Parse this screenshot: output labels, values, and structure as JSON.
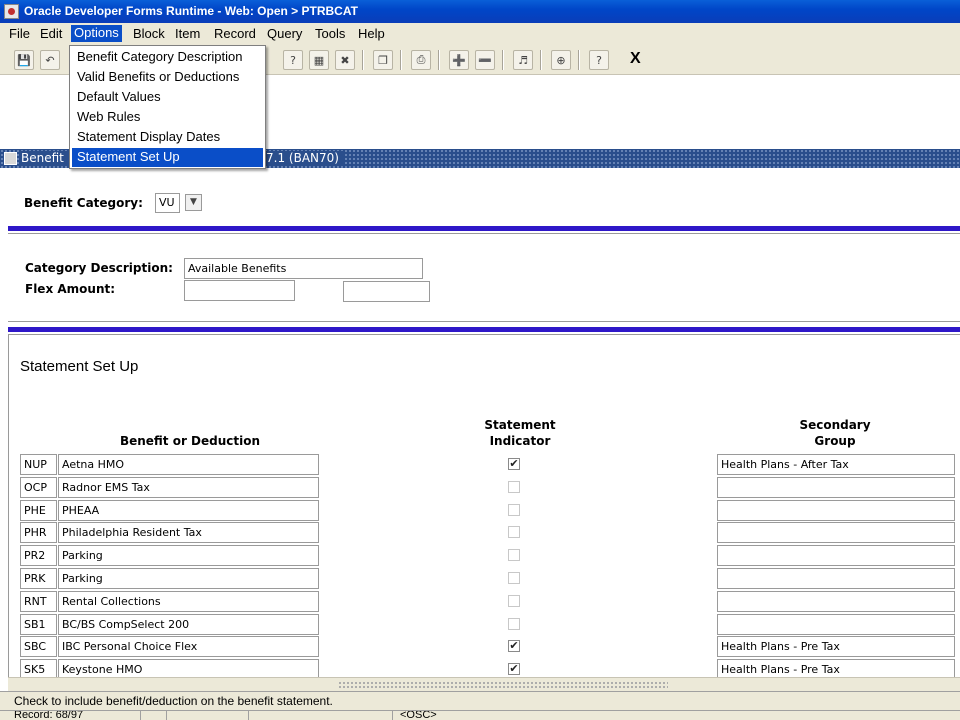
{
  "window": {
    "title": "Oracle Developer Forms Runtime - Web:  Open > PTRBCAT"
  },
  "menubar": {
    "items": [
      {
        "label": "File"
      },
      {
        "label": "Edit"
      },
      {
        "label": "Options"
      },
      {
        "label": "Block"
      },
      {
        "label": "Item"
      },
      {
        "label": "Record"
      },
      {
        "label": "Query"
      },
      {
        "label": "Tools"
      },
      {
        "label": "Help"
      }
    ],
    "active": "Options"
  },
  "toolbar": {
    "exit_label": "X"
  },
  "options_menu": {
    "items": [
      {
        "label": "Benefit Category Description"
      },
      {
        "label": "Valid Benefits or Deductions"
      },
      {
        "label": "Default Values"
      },
      {
        "label": "Web Rules"
      },
      {
        "label": "Statement Display Dates"
      },
      {
        "label": "Statement Set Up"
      }
    ],
    "selected": "Statement Set Up"
  },
  "form_bar": {
    "left_text": "Benefit",
    "right_text": "7.1  (BAN70)"
  },
  "key_block": {
    "label": "Benefit Category:",
    "value": "VU"
  },
  "header_block": {
    "category_label": "Category Description:",
    "category_value": "Available Benefits",
    "flex_label": "Flex Amount:",
    "flex_value_1": "",
    "flex_value_2": ""
  },
  "section": {
    "title": "Statement Set Up",
    "col_benefit": "Benefit or Deduction",
    "col_indicator_1": "Statement",
    "col_indicator_2": "Indicator",
    "col_group_1": "Secondary",
    "col_group_2": "Group"
  },
  "rows": [
    {
      "code": "NUP",
      "desc": "Aetna HMO",
      "checked": true,
      "group": "Health Plans - After Tax"
    },
    {
      "code": "OCP",
      "desc": "Radnor EMS Tax",
      "checked": false,
      "group": ""
    },
    {
      "code": "PHE",
      "desc": "PHEAA",
      "checked": false,
      "group": ""
    },
    {
      "code": "PHR",
      "desc": "Philadelphia Resident Tax",
      "checked": false,
      "group": ""
    },
    {
      "code": "PR2",
      "desc": "Parking",
      "checked": false,
      "group": ""
    },
    {
      "code": "PRK",
      "desc": "Parking",
      "checked": false,
      "group": ""
    },
    {
      "code": "RNT",
      "desc": "Rental Collections",
      "checked": false,
      "group": ""
    },
    {
      "code": "SB1",
      "desc": "BC/BS CompSelect 200",
      "checked": false,
      "group": ""
    },
    {
      "code": "SBC",
      "desc": "IBC Personal Choice Flex",
      "checked": true,
      "group": "Health Plans - Pre Tax"
    },
    {
      "code": "SK5",
      "desc": "Keystone HMO",
      "checked": true,
      "group": "Health Plans - Pre Tax"
    }
  ],
  "hint": "Check to include benefit/deduction on the benefit statement.",
  "status": {
    "record": "Record: 68/97",
    "mode": "<OSC>"
  }
}
